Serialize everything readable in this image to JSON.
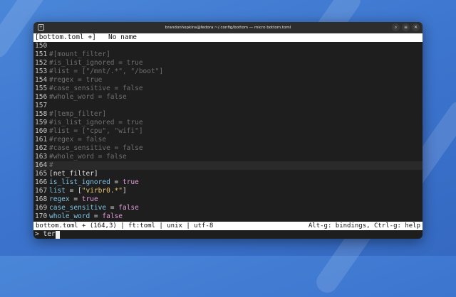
{
  "window": {
    "title": "brandonhopkins@fedora:~/.config/bottom — micro bottom.toml",
    "menu_icon": "window-menu-icon",
    "search_icon": "search-icon",
    "hamburger_icon": "hamburger-menu-icon",
    "close_icon": "close-icon"
  },
  "tab": {
    "label": "[bottom.toml +]",
    "secondary": "No name"
  },
  "lines": [
    {
      "n": "150",
      "parts": []
    },
    {
      "n": "151",
      "parts": [
        {
          "t": "#[mount_filter]",
          "c": "comment"
        }
      ]
    },
    {
      "n": "152",
      "parts": [
        {
          "t": "#is_list_ignored = true",
          "c": "comment"
        }
      ]
    },
    {
      "n": "153",
      "parts": [
        {
          "t": "#list = [\"/mnt/.*\", \"/boot\"]",
          "c": "comment"
        }
      ]
    },
    {
      "n": "154",
      "parts": [
        {
          "t": "#regex = true",
          "c": "comment"
        }
      ]
    },
    {
      "n": "155",
      "parts": [
        {
          "t": "#case_sensitive = false",
          "c": "comment"
        }
      ]
    },
    {
      "n": "156",
      "parts": [
        {
          "t": "#whole_word = false",
          "c": "comment"
        }
      ]
    },
    {
      "n": "157",
      "parts": []
    },
    {
      "n": "158",
      "parts": [
        {
          "t": "#[temp_filter]",
          "c": "comment"
        }
      ]
    },
    {
      "n": "159",
      "parts": [
        {
          "t": "#is_list_ignored = true",
          "c": "comment"
        }
      ]
    },
    {
      "n": "160",
      "parts": [
        {
          "t": "#list = [\"cpu\", \"wifi\"]",
          "c": "comment"
        }
      ]
    },
    {
      "n": "161",
      "parts": [
        {
          "t": "#regex = false",
          "c": "comment"
        }
      ]
    },
    {
      "n": "162",
      "parts": [
        {
          "t": "#case_sensitive = false",
          "c": "comment"
        }
      ]
    },
    {
      "n": "163",
      "parts": [
        {
          "t": "#whole_word = false",
          "c": "comment"
        }
      ]
    },
    {
      "n": "164",
      "current": true,
      "parts": [
        {
          "t": "#",
          "c": "comment"
        }
      ]
    },
    {
      "n": "165",
      "parts": [
        {
          "t": "[net_filter]",
          "c": "sect"
        }
      ]
    },
    {
      "n": "166",
      "parts": [
        {
          "t": "is_list_ignored",
          "c": "key"
        },
        {
          "t": " = ",
          "c": "eq"
        },
        {
          "t": "true",
          "c": "bool"
        }
      ]
    },
    {
      "n": "167",
      "parts": [
        {
          "t": "list",
          "c": "key"
        },
        {
          "t": " = [",
          "c": "eq"
        },
        {
          "t": "\"virbr0.*\"",
          "c": "str"
        },
        {
          "t": "]",
          "c": "eq"
        }
      ]
    },
    {
      "n": "168",
      "parts": [
        {
          "t": "regex",
          "c": "key"
        },
        {
          "t": " = ",
          "c": "eq"
        },
        {
          "t": "true",
          "c": "bool"
        }
      ]
    },
    {
      "n": "169",
      "parts": [
        {
          "t": "case_sensitive",
          "c": "key"
        },
        {
          "t": " = ",
          "c": "eq"
        },
        {
          "t": "false",
          "c": "bool"
        }
      ]
    },
    {
      "n": "170",
      "parts": [
        {
          "t": "whole_word",
          "c": "key"
        },
        {
          "t": " = ",
          "c": "eq"
        },
        {
          "t": "false",
          "c": "bool"
        }
      ]
    }
  ],
  "status": {
    "left": "bottom.toml + (164,3) | ft:toml | unix | utf-8",
    "right": "Alt-g: bindings, Ctrl-g: help"
  },
  "command": {
    "prompt": ">",
    "value": "ter"
  }
}
